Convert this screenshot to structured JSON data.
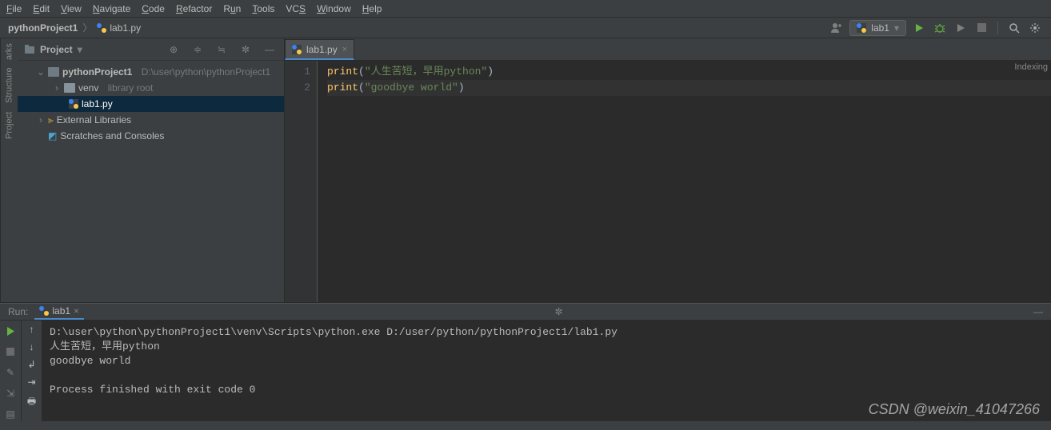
{
  "menu": [
    "File",
    "Edit",
    "View",
    "Navigate",
    "Code",
    "Refactor",
    "Run",
    "Tools",
    "VCS",
    "Window",
    "Help"
  ],
  "breadcrumb": {
    "project": "pythonProject1",
    "file": "lab1.py"
  },
  "run_config": {
    "selected": "lab1"
  },
  "status": {
    "indexing": "Indexing"
  },
  "project_panel": {
    "title": "Project",
    "root": {
      "name": "pythonProject1",
      "path": "D:\\user\\python\\pythonProject1"
    },
    "venv": {
      "name": "venv",
      "hint": "library root"
    },
    "file": "lab1.py",
    "ext_libs": "External Libraries",
    "scratches": "Scratches and Consoles"
  },
  "editor": {
    "tab": "lab1.py",
    "lines": {
      "l1": {
        "fn": "print",
        "str": "\"人生苦短，早用python\""
      },
      "l2": {
        "fn": "print",
        "str": "\"goodbye world\""
      }
    }
  },
  "run_panel": {
    "label": "Run:",
    "tab": "lab1",
    "cmd": "D:\\user\\python\\pythonProject1\\venv\\Scripts\\python.exe D:/user/python/pythonProject1/lab1.py",
    "out1": "人生苦短，早用python",
    "out2": "goodbye world",
    "exit": "Process finished with exit code 0"
  },
  "left_tabs": {
    "project": "Project",
    "structure": "Structure",
    "marks": "arks"
  },
  "watermark": "CSDN @weixin_41047266"
}
